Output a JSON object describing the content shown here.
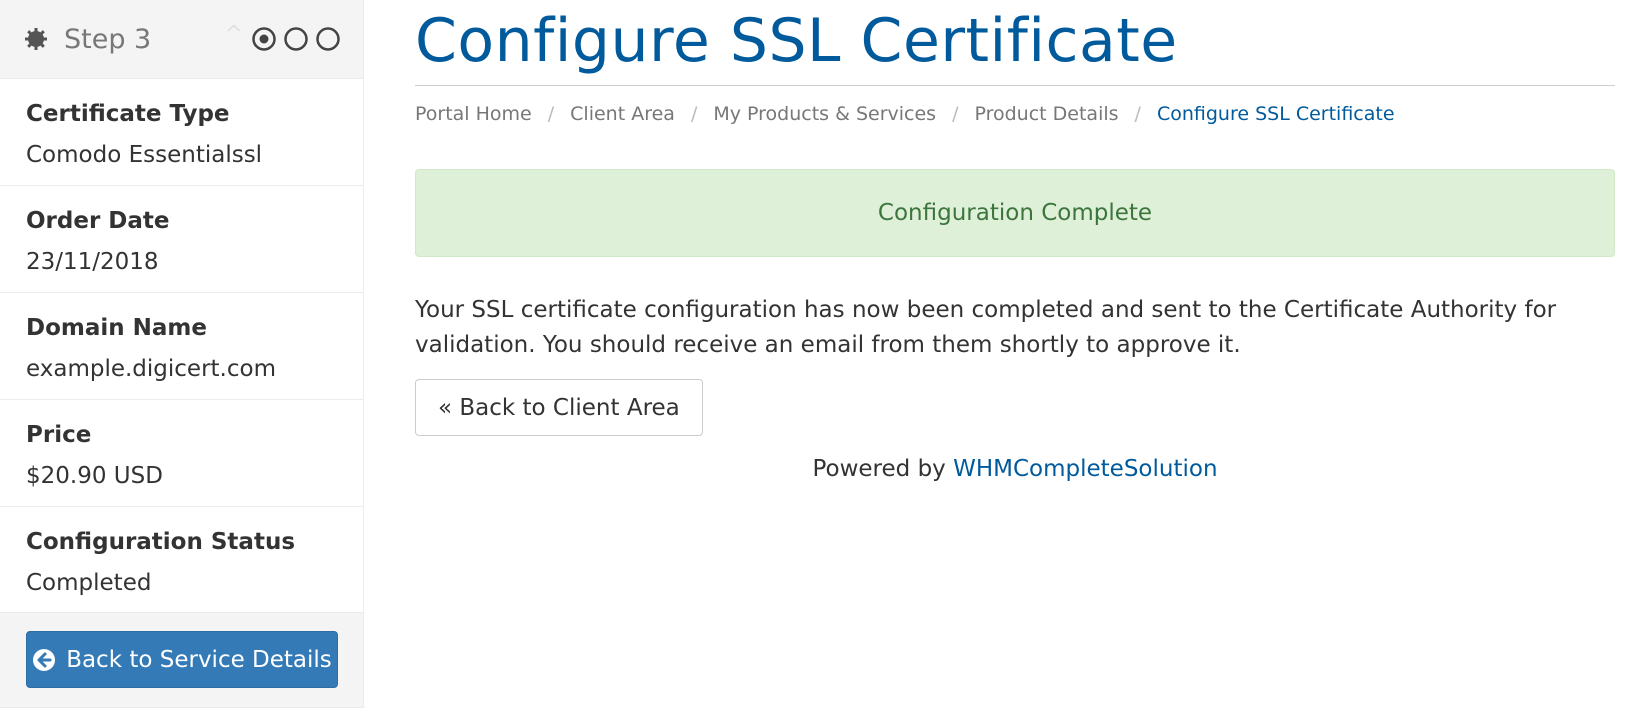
{
  "colors": {
    "brand": "#005a9c",
    "primary_button": "#337ab7",
    "success_bg": "#dff0d8",
    "success_text": "#3c763d",
    "sidebar_header_bg": "#f4f4f4"
  },
  "sidebar": {
    "step": {
      "icon": "gear-icon",
      "label": "Step 3",
      "collapse_icon": "chevron-up-icon",
      "progress": {
        "total": 3,
        "current": 1
      }
    },
    "items": [
      {
        "label": "Certificate Type",
        "value": "Comodo Essentialssl"
      },
      {
        "label": "Order Date",
        "value": "23/11/2018"
      },
      {
        "label": "Domain Name",
        "value": "example.digicert.com"
      },
      {
        "label": "Price",
        "value": "$20.90 USD"
      },
      {
        "label": "Configuration Status",
        "value": "Completed"
      }
    ],
    "back_button": {
      "icon": "arrow-circle-left-icon",
      "label": "Back to Service Details"
    }
  },
  "main": {
    "title": "Configure SSL Certificate",
    "breadcrumb": [
      {
        "label": "Portal Home"
      },
      {
        "label": "Client Area"
      },
      {
        "label": "My Products & Services"
      },
      {
        "label": "Product Details"
      },
      {
        "label": "Configure SSL Certificate",
        "active": true
      }
    ],
    "breadcrumb_separator": "/",
    "alert": "Configuration Complete",
    "message": "Your SSL certificate configuration has now been completed and sent to the Certificate Authority for validation. You should receive an email from them shortly to approve it.",
    "back_button": "« Back to Client Area",
    "footer": {
      "prefix": "Powered by ",
      "link": "WHMCompleteSolution"
    }
  }
}
